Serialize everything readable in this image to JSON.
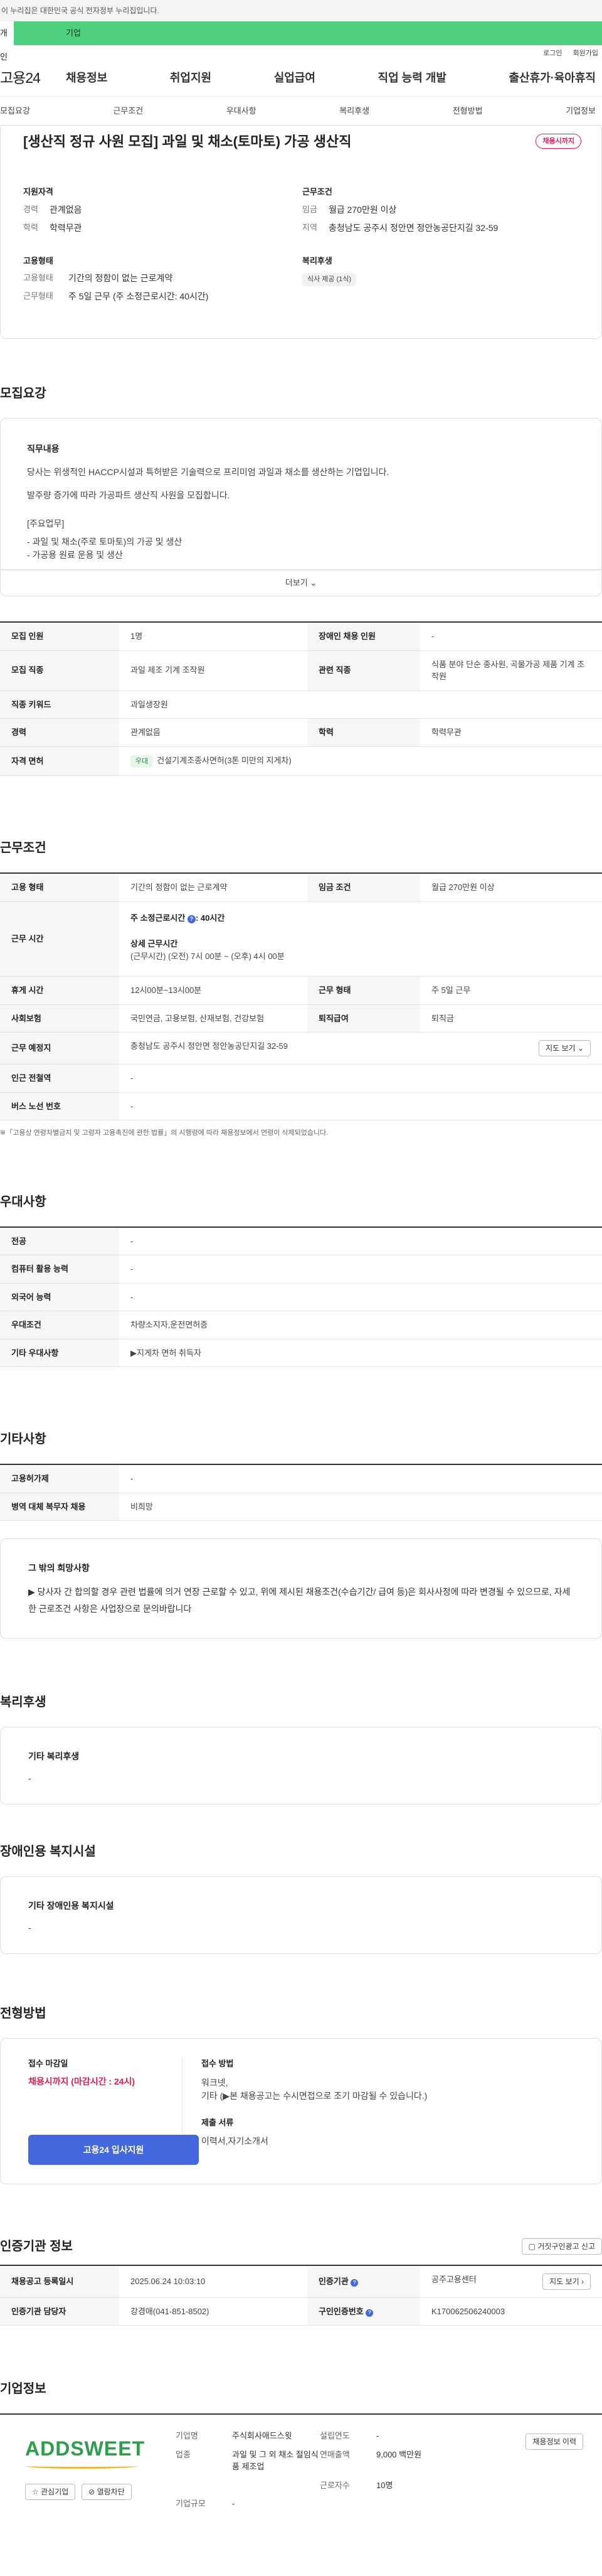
{
  "gov_banner": "이 누리집은 대한민국 공식 전자정부 누리집입니다.",
  "gnb": {
    "tab1": "개인",
    "tab2": "기업"
  },
  "util": {
    "login": "로그인",
    "join": "회원가입"
  },
  "logo": "고용24",
  "main_nav": [
    "채용정보",
    "취업지원",
    "실업급여",
    "직업 능력 개발",
    "출산휴가·육아휴직"
  ],
  "sub_nav": [
    "모집요강",
    "근무조건",
    "우대사항",
    "복리후생",
    "전형방법",
    "기업정보"
  ],
  "summary": {
    "title": "[생산직 정규 사원 모집] 과일 및 채소(토마토) 가공 생산직",
    "badge": "채용시까지",
    "qual": {
      "heading": "지원자격",
      "exp_k": "경력",
      "exp_v": "관계없음",
      "edu_k": "학력",
      "edu_v": "학력무관"
    },
    "cond": {
      "heading": "근무조건",
      "wage_k": "임금",
      "wage_v": "월급 270만원 이상",
      "loc_k": "지역",
      "loc_v": "충청남도 공주시 정안면 정안농공단지길 32-59"
    },
    "emp": {
      "heading": "고용형태",
      "type_k": "고용형태",
      "type_v": "기간의 정함이 없는 근로계약",
      "work_k": "근무형태",
      "work_v": "주 5일 근무 (주 소정근로시간: 40시간)"
    },
    "welfare": {
      "heading": "복리후생",
      "chip": "식사 제공 (1식)"
    }
  },
  "recruit": {
    "title": "모집요강",
    "desc_heading": "직무내용",
    "desc": [
      "당사는 위생적인 HACCP시설과 특허받은 기술력으로 프리미엄 과일과 채소를 생산하는 기업입니다.",
      "발주량 증가에 따라 가공파트 생산직 사원을 모집합니다.",
      "[주요업무]",
      "- 과일 및 채소(주로 토마토)의 가공 및 생산",
      "- 가공용 원료 운용 및 생산"
    ],
    "more": "더보기",
    "rows": [
      [
        "모집 인원",
        "1명",
        "장애인 채용 인원",
        "-"
      ],
      [
        "모집 직종",
        "과일 제조 기계 조작원",
        "관련 직종",
        "식품 분야 단순 종사원, 곡물가공 제품 기계 조작원"
      ],
      [
        "직종 키워드",
        "과일생장원"
      ],
      [
        "경력",
        "관계없음",
        "학력",
        "학력무관"
      ]
    ],
    "license_k": "자격 면허",
    "license_tag": "우대",
    "license_v": "건설기계조종사면허(3톤 미만의 지게차)"
  },
  "work": {
    "title": "근무조건",
    "type_k": "고용 형태",
    "type_v": "기간의 정함이 없는 근로계약",
    "wage_k": "임금 조건",
    "wage_v": "월급 270만원 이상",
    "time_k": "근무 시간",
    "time_line": "주 소정근로시간",
    "time_hours": ": 40시간",
    "time_sub": "상세 근무시간",
    "time_detail": "(근무시간) (오전) 7시 00분 ~ (오후) 4시 00분",
    "break_k": "휴게 시간",
    "break_v": "12시00분~13시00분",
    "form_k": "근무 형태",
    "form_v": "주 5일 근무",
    "ins_k": "사회보험",
    "ins_v": "국민연금, 고용보험, 산재보험, 건강보험",
    "ret_k": "퇴직급여",
    "ret_v": "퇴직금",
    "place_k": "근무 예정지",
    "place_v": "충청남도 공주시 정안면 정안농공단지길 32-59",
    "map_btn": "지도 보기",
    "sub_k": "인근 전철역",
    "sub_v": "-",
    "bus_k": "버스 노선 번호",
    "bus_v": "-",
    "note": "※「고용상 연령차별금지 및 고령자 고용촉진에 관한 법률」의 시행령에 따라 채용정보에서 연령이 삭제되었습니다."
  },
  "pref": {
    "title": "우대사항",
    "rows": [
      [
        "전공",
        "-"
      ],
      [
        "컴퓨터 활용 능력",
        "-"
      ],
      [
        "외국어 능력",
        "-"
      ],
      [
        "우대조건",
        "차량소지자,운전면허증"
      ],
      [
        "기타 우대사항",
        "▶지게차 면허 취득자"
      ]
    ]
  },
  "other": {
    "title": "기타사항",
    "rows": [
      [
        "고용허가제",
        "-"
      ],
      [
        "병역 대체 복무자 채용",
        "비희망"
      ]
    ],
    "hope_heading": "그 밖의 희망사항",
    "hope_text": "▶ 당사자 간 합의할 경우 관련 법률에 의거 연장 근로할 수 있고, 위에 제시된 채용조건(수습기간/ 급여 등)은 회사사정에 따라 변경될 수 있으므로, 자세한 근로조건 사항은 사업장으로 문의바랍니다"
  },
  "welfare2": {
    "title": "복리후생",
    "heading": "기타 복리후생",
    "value": "-"
  },
  "disabled": {
    "title": "장애인용 복지시설",
    "heading": "기타 장애인용 복지시설",
    "value": "-"
  },
  "process": {
    "title": "전형방법",
    "deadline_k": "접수 마감일",
    "deadline_v": "채용시까지 (마감시간 : 24시)",
    "apply": "고용24 입사지원",
    "method_k": "접수 방법",
    "method_v1": "워크넷,",
    "method_v2": "기타 (▶본 채용공고는 수시면접으로 조기 마감될 수 있습니다.)",
    "docs_k": "제출 서류",
    "docs_v": "이력서,자기소개서"
  },
  "cert": {
    "title": "인증기관 정보",
    "report_btn": "거짓구인광고 신고",
    "reg_k": "채용공고 등록일시",
    "reg_v": "2025.06.24 10:03:10",
    "org_k": "인증기관",
    "org_v": "공주고용센터",
    "map_btn": "지도 보기",
    "mgr_k": "인증기관 담당자",
    "mgr_v": "강경애(041-851-8502)",
    "num_k": "구인인증번호",
    "num_v": "K170062506240003"
  },
  "company": {
    "title": "기업정보",
    "logo_text": "ADDSWEET",
    "fav": "관심기업",
    "block": "열람차단",
    "list_btn": "채용정보 이력",
    "name_k": "기업명",
    "name_v": "주식회사애드스윗",
    "est_k": "설립연도",
    "est_v": "-",
    "ind_k": "업종",
    "ind_v": "과일 및 그 외 채소 절임식품 제조업",
    "sales_k": "연매출액",
    "sales_v": "9,000 백만원",
    "emp_k": "근로자수",
    "emp_v": "10명",
    "size_k": "기업규모",
    "size_v": "-"
  }
}
